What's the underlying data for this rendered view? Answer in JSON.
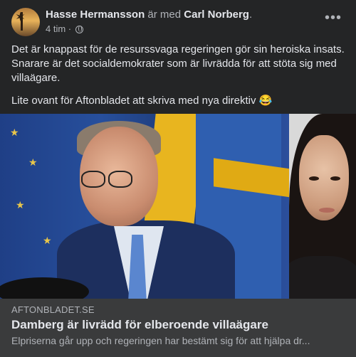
{
  "post": {
    "author": "Hasse Hermansson",
    "with_text": "är med",
    "tagged": "Carl Norberg",
    "tagged_suffix": ".",
    "time": "4 tim",
    "time_sep": "·",
    "privacy_icon": "globe-icon",
    "more_label": "•••",
    "paragraph1": "Det är knappast för de resurssvaga regeringen gör sin heroiska insats. Snarare är det socialdemokrater som är livrädda för att stöta sig med villaägare.",
    "paragraph2": "Lite ovant för Aftonbladet att skriva med nya direktiv 😂"
  },
  "link_preview": {
    "domain": "AFTONBLADET.SE",
    "headline": "Damberg är livrädd för elberoende villaägare",
    "description": "Elpriserna går upp och regeringen har bestämt sig för att hjälpa dr..."
  },
  "colors": {
    "card_bg": "#242526",
    "preview_bg": "#3a3b3c",
    "text_primary": "#e4e6eb",
    "text_secondary": "#b0b3b8"
  }
}
